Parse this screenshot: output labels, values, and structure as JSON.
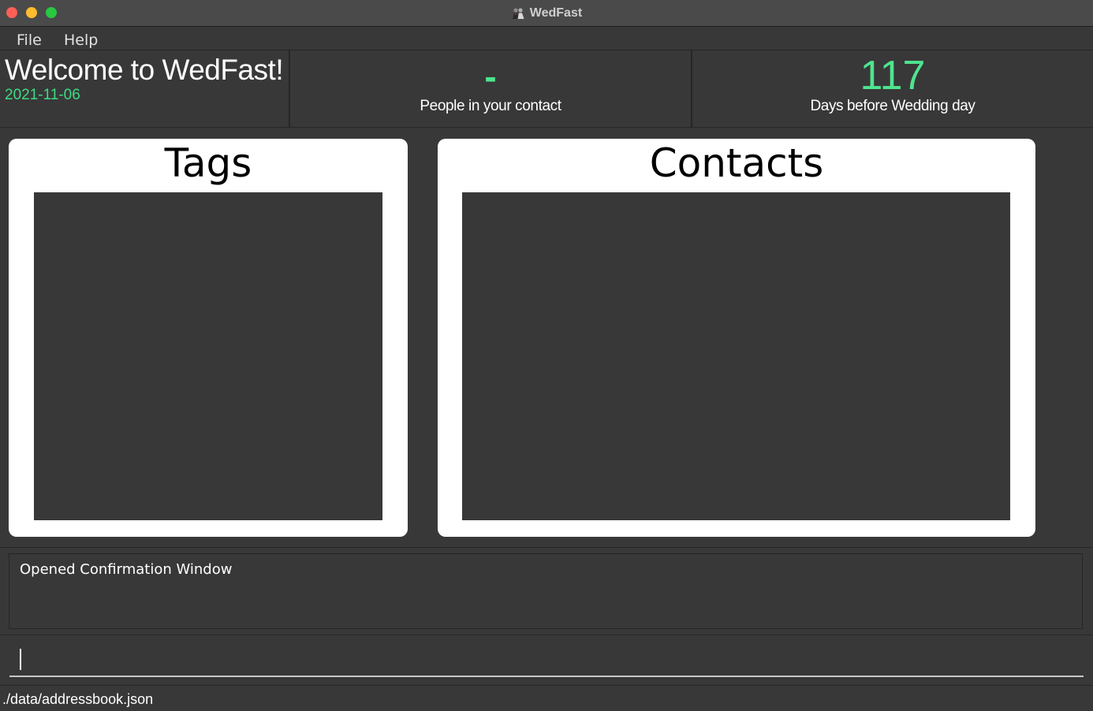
{
  "window": {
    "title": "WedFast",
    "app_icon": "wedding-couple-icon"
  },
  "menu": {
    "file_label": "File",
    "help_label": "Help"
  },
  "header": {
    "welcome": "Welcome to WedFast!",
    "date": "2021-11-06",
    "people_count": "-",
    "people_label": "People in your contact",
    "days_count": "117",
    "days_label": "Days before Wedding day"
  },
  "panels": {
    "tags_title": "Tags",
    "contacts_title": "Contacts"
  },
  "result": {
    "message": "Opened Confirmation Window"
  },
  "command": {
    "value": "",
    "placeholder": ""
  },
  "status": {
    "path": "./data/addressbook.json"
  },
  "colors": {
    "background": "#383838",
    "accent_green": "#4ee58f",
    "panel_white": "#ffffff",
    "close": "#ff5f57",
    "minimize": "#febc2e",
    "zoom": "#28c840"
  }
}
